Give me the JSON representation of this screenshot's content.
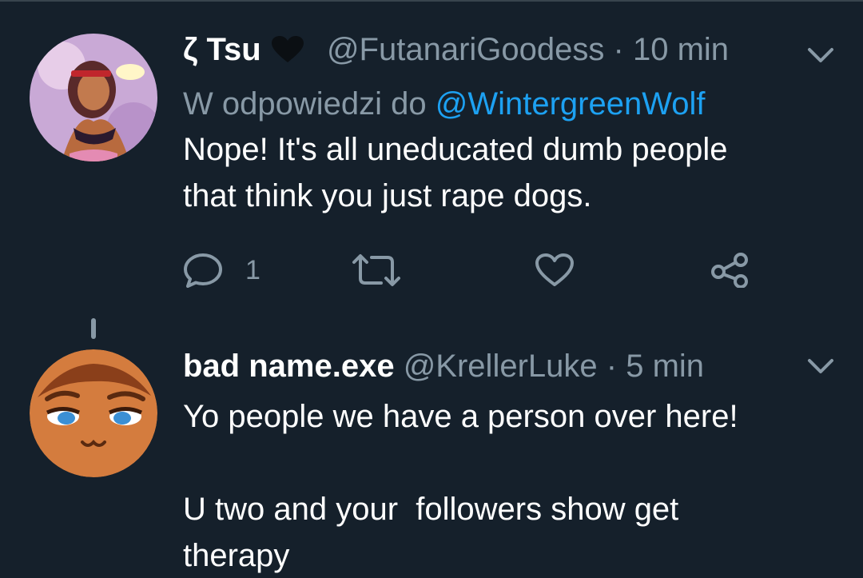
{
  "tweets": [
    {
      "display_name": "ζ Tsu",
      "handle": "@FutanariGoodess",
      "separator": "·",
      "time": "10 min",
      "reply_prefix": "W odpowiedzi do",
      "reply_to": "@WintergreenWolf",
      "text": "Nope! It's all uneducated dumb people\nthat think you just rape dogs.",
      "reply_count": "1",
      "icons": [
        "reply-icon",
        "retweet-icon",
        "like-icon",
        "share-icon",
        "chevron-down-icon",
        "heart-icon"
      ]
    },
    {
      "display_name": "bad name.exe",
      "handle": "@KrellerLuke",
      "separator": "·",
      "time": "5 min",
      "text": "Yo people we have a person over here!\n\nU two and your  followers show get\ntherapy",
      "icons": [
        "chevron-down-icon"
      ]
    }
  ],
  "colors": {
    "background": "#15202b",
    "secondary_text": "#8899a6",
    "primary_text": "#ffffff",
    "link": "#1da1f2",
    "divider": "#38444d"
  }
}
